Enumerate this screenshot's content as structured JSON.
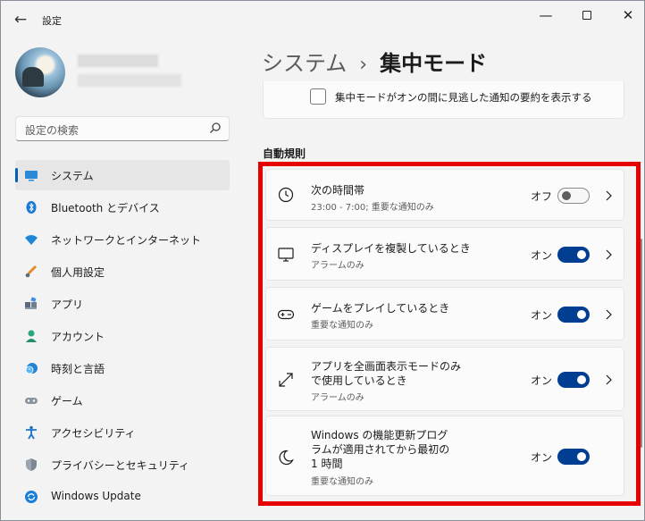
{
  "window": {
    "title": "設定",
    "back_icon": "arrow-left-icon",
    "controls": [
      "minimize-icon",
      "maximize-icon",
      "close-icon"
    ]
  },
  "sidebar": {
    "search_placeholder": "設定の検索",
    "items": [
      {
        "label": "システム",
        "icon": "monitor-icon",
        "active": true
      },
      {
        "label": "Bluetooth とデバイス",
        "icon": "bluetooth-icon",
        "active": false
      },
      {
        "label": "ネットワークとインターネット",
        "icon": "wifi-icon",
        "active": false
      },
      {
        "label": "個人用設定",
        "icon": "brush-icon",
        "active": false
      },
      {
        "label": "アプリ",
        "icon": "apps-icon",
        "active": false
      },
      {
        "label": "アカウント",
        "icon": "person-icon",
        "active": false
      },
      {
        "label": "時刻と言語",
        "icon": "clock-globe-icon",
        "active": false
      },
      {
        "label": "ゲーム",
        "icon": "gamepad-icon",
        "active": false
      },
      {
        "label": "アクセシビリティ",
        "icon": "accessibility-icon",
        "active": false
      },
      {
        "label": "プライバシーとセキュリティ",
        "icon": "shield-icon",
        "active": false
      },
      {
        "label": "Windows Update",
        "icon": "update-icon",
        "active": false
      }
    ]
  },
  "main": {
    "breadcrumb": {
      "parent": "システム",
      "separator": "›",
      "current": "集中モード"
    },
    "summary_checkbox_label": "集中モードがオンの間に見逃した通知の要約を表示する",
    "section_title": "自動規則",
    "rules": [
      {
        "icon": "clock-icon",
        "title": "次の時間帯",
        "subtitle": "23:00 - 7:00; 重要な通知のみ",
        "state": "オフ",
        "on": false,
        "chevron": true
      },
      {
        "icon": "monitor-icon",
        "title": "ディスプレイを複製しているとき",
        "subtitle": "アラームのみ",
        "state": "オン",
        "on": true,
        "chevron": true
      },
      {
        "icon": "gamepad-icon",
        "title": "ゲームをプレイしているとき",
        "subtitle": "重要な通知のみ",
        "state": "オン",
        "on": true,
        "chevron": true
      },
      {
        "icon": "expand-arrows-icon",
        "title": "アプリを全画面表示モードのみで使用しているとき",
        "subtitle": "アラームのみ",
        "state": "オン",
        "on": true,
        "chevron": true
      },
      {
        "icon": "moon-icon",
        "title": "Windows の機能更新プログラムが適用されてから最初の 1 時間",
        "subtitle": "重要な通知のみ",
        "state": "オン",
        "on": true,
        "chevron": false
      }
    ]
  },
  "colors": {
    "accent": "#005fb8",
    "toggle_on": "#003e92",
    "highlight_frame": "#e60000"
  }
}
